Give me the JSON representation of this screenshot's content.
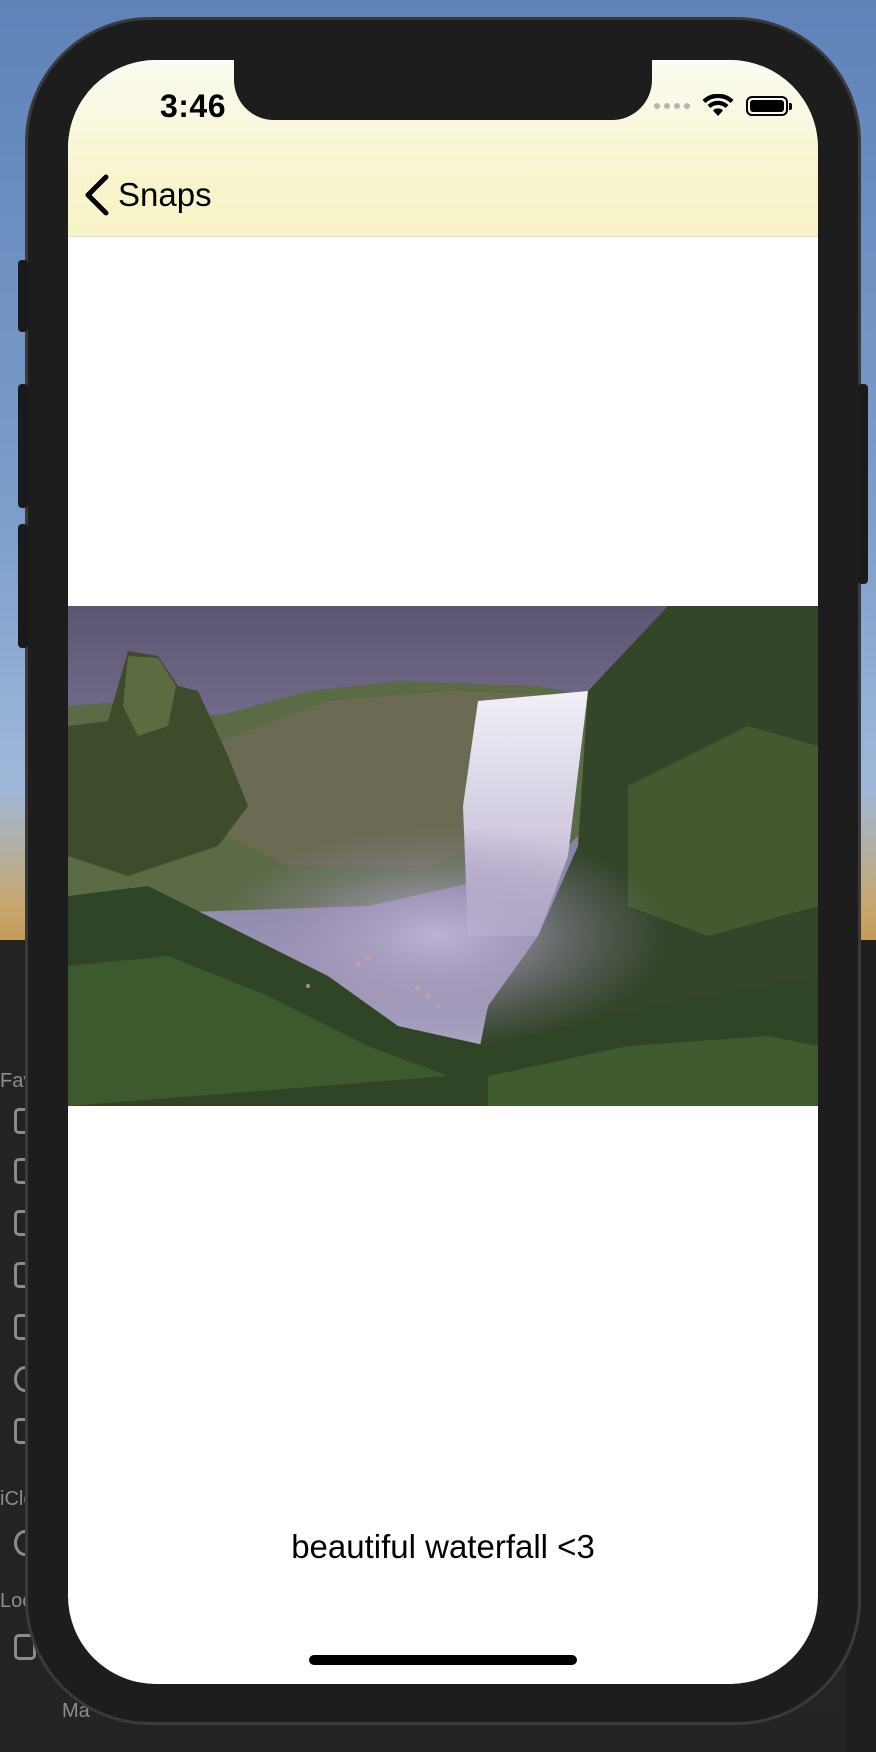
{
  "status_bar": {
    "time": "3:46"
  },
  "nav": {
    "back_label": "Snaps"
  },
  "photo": {
    "subject": "waterfall photo"
  },
  "caption": {
    "text": "beautiful waterfall <3"
  },
  "desktop": {
    "sidebar_fragments": [
      "Fav",
      "iClo",
      "Loc",
      "Ma"
    ]
  }
}
